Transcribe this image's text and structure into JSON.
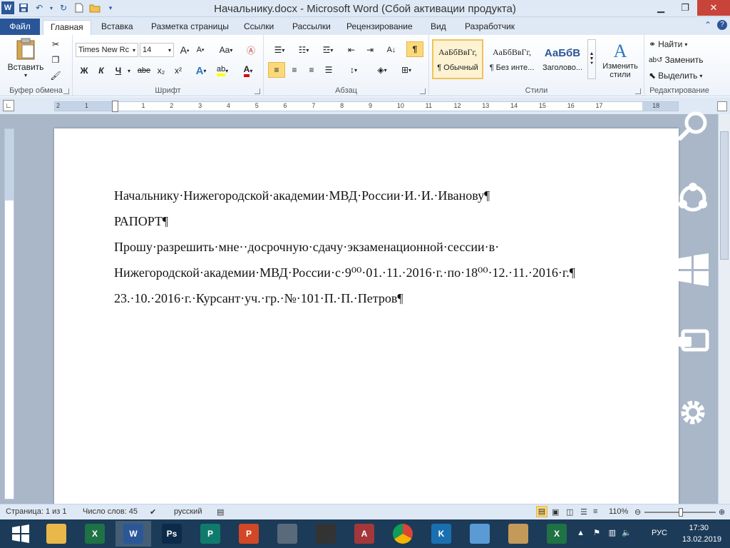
{
  "window": {
    "title": "Начальнику.docx  -  Microsoft Word (Сбой активации продукта)"
  },
  "tabs": [
    {
      "label": "Файл"
    },
    {
      "label": "Главная"
    },
    {
      "label": "Вставка"
    },
    {
      "label": "Разметка страницы"
    },
    {
      "label": "Ссылки"
    },
    {
      "label": "Рассылки"
    },
    {
      "label": "Рецензирование"
    },
    {
      "label": "Вид"
    },
    {
      "label": "Разработчик"
    }
  ],
  "ribbon": {
    "clipboard": {
      "group_label": "Буфер обмена",
      "paste_label": "Вставить"
    },
    "font": {
      "group_label": "Шрифт",
      "font_name": "Times New Rc",
      "font_size": "14",
      "bold": "Ж",
      "italic": "К",
      "underline": "Ч",
      "strike": "abe",
      "sub": "x₂",
      "sup": "x²",
      "change_case": "Aa",
      "grow": "A",
      "shrink": "A"
    },
    "paragraph": {
      "group_label": "Абзац"
    },
    "styles": {
      "group_label": "Стили",
      "items": [
        {
          "sample": "АаБбВвГг,",
          "label": "¶ Обычный"
        },
        {
          "sample": "АаБбВвГг,",
          "label": "¶ Без инте..."
        },
        {
          "sample": "АаБбВ",
          "label": "Заголово..."
        }
      ],
      "change_styles": "Изменить стили"
    },
    "editing": {
      "group_label": "Редактирование",
      "find": "Найти",
      "replace": "Заменить",
      "select": "Выделить"
    }
  },
  "ruler": {
    "ticks": [
      "2",
      "1",
      "",
      "1",
      "2",
      "3",
      "4",
      "5",
      "6",
      "7",
      "8",
      "9",
      "10",
      "11",
      "12",
      "13",
      "14",
      "15",
      "16",
      "17",
      "",
      "18"
    ]
  },
  "document": {
    "paragraphs": [
      "Начальнику·Нижегородской·академии·МВД·России·И.·И.·Иванову¶",
      "РАПОРТ¶",
      "Прошу·разрешить·мне··досрочную·сдачу·экзаменационной·сессии·в·",
      "Нижегородской·академии·МВД·России·с·9⁰⁰·01.·11.·2016·г.·по·18⁰⁰·12.·11.·2016·г.¶",
      "23.·10.·2016·г.·Курсант·уч.·гр.·№·101·П.·П.·Петров¶"
    ]
  },
  "status": {
    "page": "Страница: 1 из 1",
    "words": "Число слов: 45",
    "language": "русский",
    "zoom": "110%"
  },
  "taskbar": {
    "apps": [
      {
        "name": "file-explorer",
        "label": ""
      },
      {
        "name": "excel",
        "label": "X"
      },
      {
        "name": "word",
        "label": "W"
      },
      {
        "name": "photoshop",
        "label": "Ps"
      },
      {
        "name": "publisher",
        "label": "P"
      },
      {
        "name": "powerpoint",
        "label": "P"
      },
      {
        "name": "calculator",
        "label": ""
      },
      {
        "name": "video-player",
        "label": ""
      },
      {
        "name": "access",
        "label": "A"
      },
      {
        "name": "chrome",
        "label": ""
      },
      {
        "name": "app-k",
        "label": "K"
      },
      {
        "name": "notepad",
        "label": ""
      },
      {
        "name": "paint",
        "label": ""
      },
      {
        "name": "excel-2",
        "label": "X"
      }
    ],
    "tray": {
      "lang": "РУС",
      "time": "17:30",
      "date": "13.02.2019"
    }
  },
  "colors": {
    "accent": "#2a5699",
    "word_blue": "#2b5797",
    "taskbar": "#1c3b58"
  }
}
